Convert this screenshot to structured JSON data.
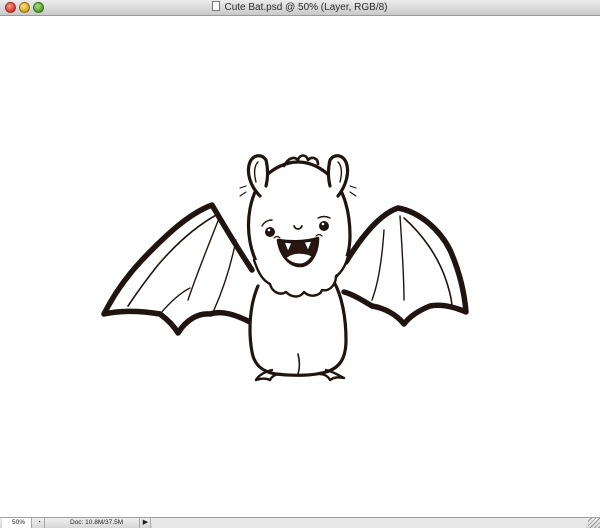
{
  "window": {
    "title": "Cute Bat.psd @ 50% (Layer, RGB/8)",
    "controls": [
      "close",
      "minimize",
      "zoom"
    ]
  },
  "canvas": {
    "artwork": "cute-bat-line-drawing",
    "background": "#ffffff",
    "stroke_color": "#1f1410"
  },
  "statusbar": {
    "zoom": "50%",
    "doc_info": "Doc: 10.8M/37.5M",
    "arrow": "▶"
  }
}
